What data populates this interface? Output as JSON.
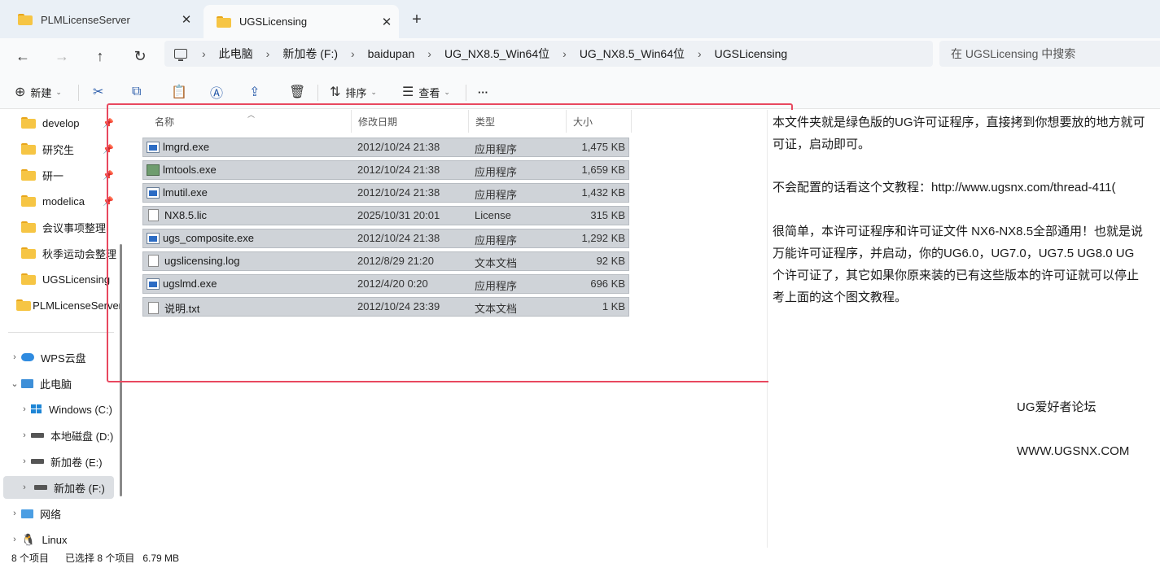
{
  "tabs": [
    {
      "label": "PLMLicenseServer",
      "active": false
    },
    {
      "label": "UGSLicensing",
      "active": true
    }
  ],
  "new_tab": "+",
  "nav": {
    "back": "←",
    "forward": "→",
    "up": "↑",
    "refresh": "↻"
  },
  "breadcrumb": [
    "此电脑",
    "新加卷 (F:)",
    "baidupan",
    "UG_NX8.5_Win64位",
    "UG_NX8.5_Win64位",
    "UGSLicensing"
  ],
  "search": {
    "placeholder": "在 UGSLicensing 中搜索"
  },
  "toolbar": {
    "new": "新建",
    "sort": "排序",
    "view": "查看",
    "more": "···"
  },
  "sidebar": {
    "quick": [
      "develop",
      "研究生",
      "研一",
      "modelica",
      "会议事项整理",
      "秋季运动会整理",
      "UGSLicensing",
      "PLMLicenseServer"
    ],
    "wps": "WPS云盘",
    "pc": "此电脑",
    "drives": [
      "Windows (C:)",
      "本地磁盘 (D:)",
      "新加卷 (E:)",
      "新加卷 (F:)"
    ],
    "network": "网络",
    "linux": "Linux"
  },
  "columns": {
    "name": "名称",
    "date": "修改日期",
    "type": "类型",
    "size": "大小"
  },
  "files": [
    {
      "name": "lmgrd.exe",
      "date": "2012/10/24 21:38",
      "type": "应用程序",
      "size": "1,475 KB",
      "icon": "exe-icon"
    },
    {
      "name": "lmtools.exe",
      "date": "2012/10/24 21:38",
      "type": "应用程序",
      "size": "1,659 KB",
      "icon": "tools-icon"
    },
    {
      "name": "lmutil.exe",
      "date": "2012/10/24 21:38",
      "type": "应用程序",
      "size": "1,432 KB",
      "icon": "exe-icon"
    },
    {
      "name": "NX8.5.lic",
      "date": "2025/10/31 20:01",
      "type": "License",
      "size": "315 KB",
      "icon": "doc-icon"
    },
    {
      "name": "ugs_composite.exe",
      "date": "2012/10/24 21:38",
      "type": "应用程序",
      "size": "1,292 KB",
      "icon": "exe-icon"
    },
    {
      "name": "ugslicensing.log",
      "date": "2012/8/29 21:20",
      "type": "文本文档",
      "size": "92 KB",
      "icon": "doc-icon"
    },
    {
      "name": "ugslmd.exe",
      "date": "2012/4/20 0:20",
      "type": "应用程序",
      "size": "696 KB",
      "icon": "exe-icon"
    },
    {
      "name": "说明.txt",
      "date": "2012/10/24 23:39",
      "type": "文本文档",
      "size": "1 KB",
      "icon": "doc-icon"
    }
  ],
  "preview": {
    "lines": [
      "本文件夹就是绿色版的UG许可证程序，直接拷到你想要放的地方就可",
      "可证，启动即可。",
      "不会配置的话看这个文教程：http://www.ugsnx.com/thread-411(",
      "很简单，本许可证程序和许可证文件 NX6-NX8.5全部通用！也就是说",
      "万能许可证程序，并启动，你的UG6.0，UG7.0，UG7.5 UG8.0 UG",
      "个许可证了，其它如果你原来装的已有这些版本的许可证就可以停止",
      "考上面的这个图文教程。",
      "UG爱好者论坛",
      "WWW.UGSNX.COM"
    ]
  },
  "status": {
    "count": "8 个项目",
    "selected": "已选择 8 个项目",
    "size": "6.79 MB"
  }
}
